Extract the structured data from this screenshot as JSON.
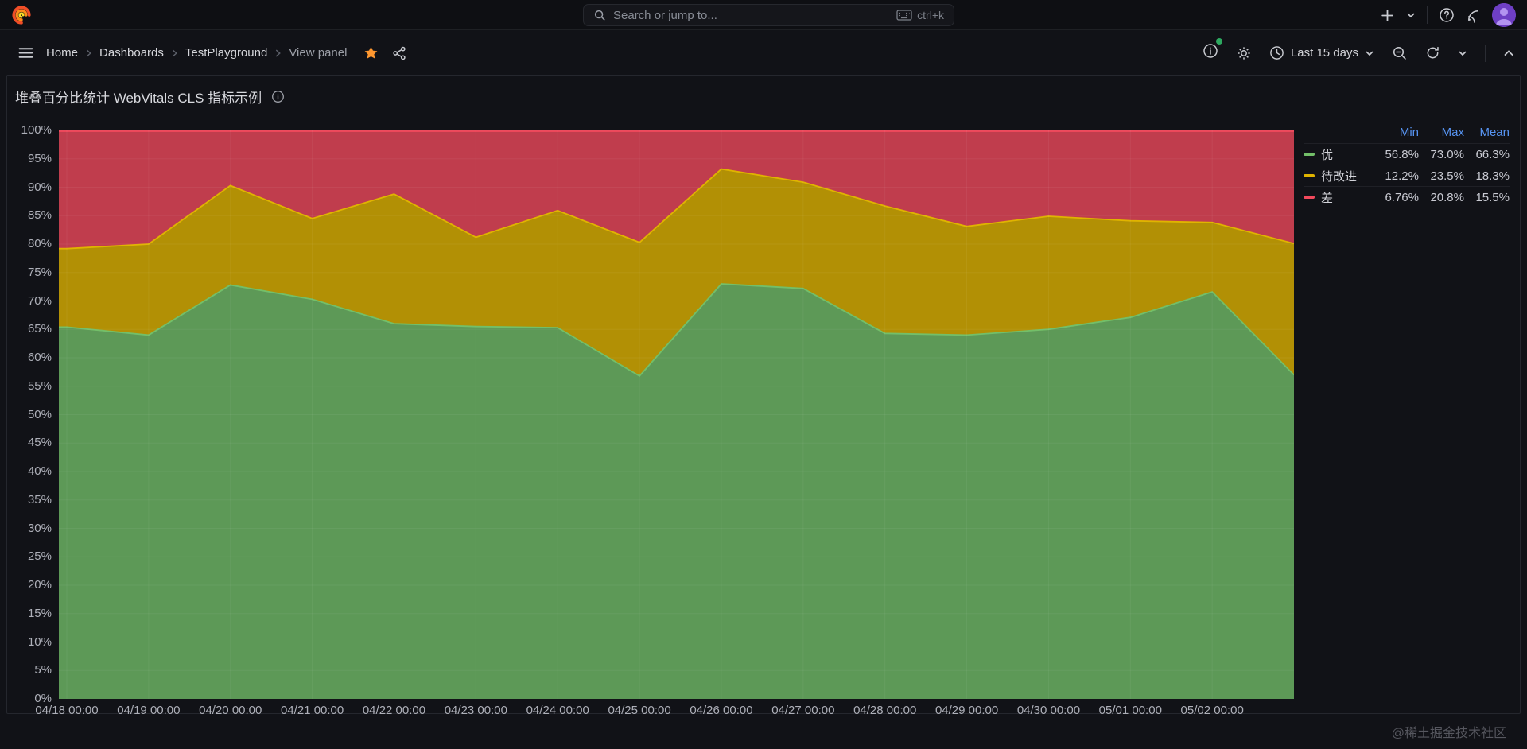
{
  "topbar": {
    "search_placeholder": "Search or jump to...",
    "shortcut": "ctrl+k"
  },
  "breadcrumb": {
    "items": [
      "Home",
      "Dashboards",
      "TestPlayground",
      "View panel"
    ]
  },
  "toolbar": {
    "time_range": "Last 15 days"
  },
  "panel": {
    "title": "堆叠百分比统计 WebVitals CLS 指标示例"
  },
  "legend": {
    "columns": [
      "Min",
      "Max",
      "Mean"
    ],
    "rows": [
      {
        "label": "优",
        "color": "#73BF69",
        "min": "56.8%",
        "max": "73.0%",
        "mean": "66.3%"
      },
      {
        "label": "待改进",
        "color": "#E0B400",
        "min": "12.2%",
        "max": "23.5%",
        "mean": "18.3%"
      },
      {
        "label": "差",
        "color": "#F2495C",
        "min": "6.76%",
        "max": "20.8%",
        "mean": "15.5%"
      }
    ]
  },
  "chart_data": {
    "type": "area",
    "stacked": "percent",
    "title": "堆叠百分比统计 WebVitals CLS 指标示例",
    "x_labels": [
      "04/18 00:00",
      "04/19 00:00",
      "04/20 00:00",
      "04/21 00:00",
      "04/22 00:00",
      "04/23 00:00",
      "04/24 00:00",
      "04/25 00:00",
      "04/26 00:00",
      "04/27 00:00",
      "04/28 00:00",
      "04/29 00:00",
      "04/30 00:00",
      "05/01 00:00",
      "05/02 00:00"
    ],
    "x_days": [
      0,
      1,
      2,
      3,
      4,
      5,
      6,
      7,
      8,
      9,
      10,
      11,
      12,
      13,
      14,
      15
    ],
    "y_ticks": [
      "0%",
      "5%",
      "10%",
      "15%",
      "20%",
      "25%",
      "30%",
      "35%",
      "40%",
      "45%",
      "50%",
      "55%",
      "60%",
      "65%",
      "70%",
      "75%",
      "80%",
      "85%",
      "90%",
      "95%",
      "100%"
    ],
    "ylim": [
      0,
      100
    ],
    "grid": true,
    "legend_position": "right-top",
    "series": [
      {
        "name": "优",
        "color": "#73BF69",
        "fill": "#5D9957",
        "values": [
          65.4,
          64.0,
          72.8,
          70.3,
          66.0,
          65.5,
          65.3,
          56.8,
          73.0,
          72.2,
          64.3,
          64.0,
          65.0,
          67.1,
          71.6,
          57.0
        ]
      },
      {
        "name": "待改进",
        "color": "#E0B400",
        "fill": "#B29005",
        "values": [
          13.8,
          16.0,
          17.5,
          14.2,
          22.8,
          15.7,
          20.6,
          23.5,
          20.2,
          18.7,
          22.4,
          19.1,
          19.9,
          17.0,
          12.2,
          23.1
        ]
      },
      {
        "name": "差",
        "color": "#F2495C",
        "fill": "#C03D4D",
        "values": [
          20.8,
          20.0,
          9.7,
          15.5,
          11.2,
          18.8,
          14.1,
          19.7,
          6.8,
          9.1,
          13.3,
          16.9,
          15.1,
          15.9,
          16.2,
          19.9
        ]
      }
    ]
  },
  "watermark": "@稀土掘金技术社区",
  "icons": {
    "topbar": [
      "grafana-logo",
      "search",
      "keyboard",
      "plus",
      "chevron-down",
      "help-circle",
      "rss",
      "user-avatar"
    ],
    "toolbar": [
      "menu",
      "chevron-right",
      "star-filled",
      "share-alt",
      "info-circle",
      "notification-dot",
      "gear",
      "clock",
      "chevron-down",
      "zoom-out-magnifier",
      "refresh",
      "chevron-up"
    ],
    "panel": [
      "info-circle"
    ]
  }
}
